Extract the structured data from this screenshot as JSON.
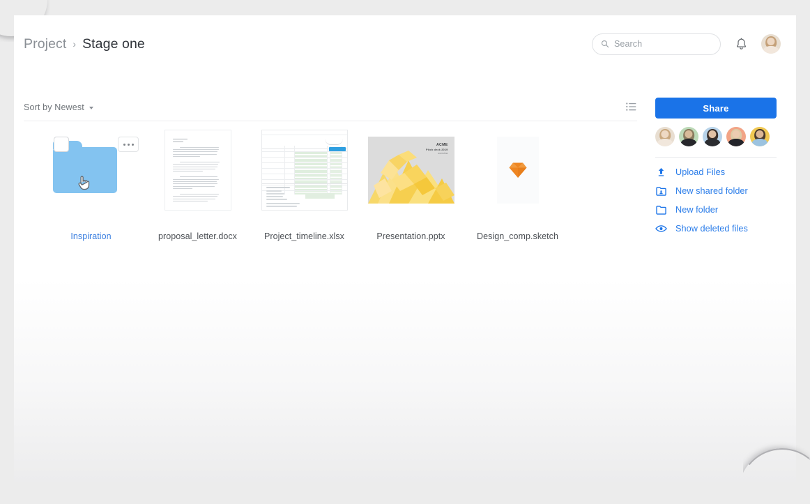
{
  "header": {
    "breadcrumb_root": "Project",
    "breadcrumb_separator": "›",
    "breadcrumb_current": "Stage one",
    "search_placeholder": "Search",
    "search_value": "",
    "search_icon": "search-icon",
    "bell_icon": "bell-icon",
    "avatar_name": "user-avatar"
  },
  "toolbar": {
    "sort_label": "Sort by Newest",
    "sort_caret_icon": "chevron-down-icon",
    "view_toggle_icon": "list-view-icon"
  },
  "files": [
    {
      "name": "Inspiration",
      "type": "folder",
      "selected": true,
      "checkbox_icon": "checkbox-icon",
      "menu_icon": "more-options-icon",
      "cursor_icon": "hand-cursor-icon"
    },
    {
      "name": "proposal_letter.docx",
      "type": "document",
      "selected": false
    },
    {
      "name": "Project_timeline.xlsx",
      "type": "spreadsheet",
      "selected": false
    },
    {
      "name": "Presentation.pptx",
      "type": "presentation",
      "selected": false,
      "thumb_brand_line1": "ACME",
      "thumb_brand_line2": "Pitch deck 2019",
      "thumb_brand_line3": "overview"
    },
    {
      "name": "Design_comp.sketch",
      "type": "sketch",
      "selected": false,
      "thumb_icon": "sketch-diamond-icon"
    }
  ],
  "sidebar": {
    "share_label": "Share",
    "collaborators": [
      {
        "name": "collaborator-1",
        "bg": "#e8ded1",
        "hair": "#c8a882",
        "body": "#f0e6da"
      },
      {
        "name": "collaborator-2",
        "bg": "#bcd9b7",
        "hair": "#8a7b5e",
        "body": "#26272b"
      },
      {
        "name": "collaborator-3",
        "bg": "#b9d4ea",
        "hair": "#3a2f2a",
        "body": "#2b2c30"
      },
      {
        "name": "collaborator-4",
        "bg": "#f2a486",
        "hair": "#d9c7a3",
        "body": "#23242a"
      },
      {
        "name": "collaborator-5",
        "bg": "#f0c852",
        "hair": "#4a3a2c",
        "body": "#9cc3e0"
      }
    ],
    "actions": [
      {
        "label": "Upload Files",
        "icon": "upload-icon"
      },
      {
        "label": "New shared folder",
        "icon": "shared-folder-icon"
      },
      {
        "label": "New folder",
        "icon": "folder-icon"
      },
      {
        "label": "Show deleted files",
        "icon": "eye-icon"
      }
    ]
  },
  "colors": {
    "accent_blue": "#1a73e8",
    "link_blue": "#2b7de9",
    "folder_blue": "#83c3f0",
    "sketch_orange": "#ee8622",
    "page_bg": "#ececec"
  }
}
